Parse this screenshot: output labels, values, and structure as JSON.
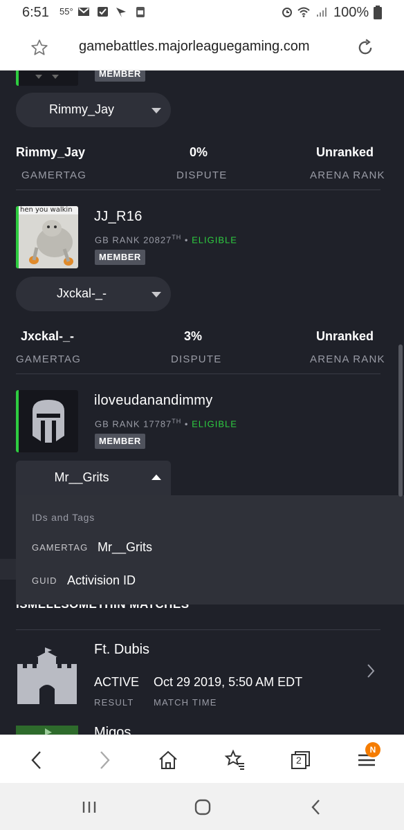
{
  "status_bar": {
    "time": "6:51",
    "temp": "55°",
    "battery": "100%"
  },
  "browser": {
    "url": "gamebattles.majorleaguegaming.com",
    "tabs_count": "2",
    "menu_badge": "N"
  },
  "members": [
    {
      "badge": "MEMBER",
      "selected_gamertag": "Rimmy_Jay",
      "stats": {
        "gamertag": "Rimmy_Jay",
        "dispute": "0%",
        "arena_rank": "Unranked"
      }
    },
    {
      "name": "JJ_R16",
      "gb_rank_prefix": "GB RANK 20827",
      "gb_rank_suffix": "TH",
      "eligibility": "ELIGIBLE",
      "badge": "MEMBER",
      "avatar_caption": "hen you walkin",
      "selected_gamertag": "Jxckal-_-",
      "stats": {
        "gamertag": "Jxckal-_-",
        "dispute": "3%",
        "arena_rank": "Unranked"
      }
    },
    {
      "name": "iloveudanandimmy",
      "gb_rank_prefix": "GB RANK 17787",
      "gb_rank_suffix": "TH",
      "eligibility": "ELIGIBLE",
      "badge": "MEMBER",
      "selected_gamertag": "Mr__Grits"
    }
  ],
  "stat_labels": {
    "gamertag": "GAMERTAG",
    "dispute": "DISPUTE",
    "arena_rank": "ARENA RANK"
  },
  "dropdown": {
    "group_label": "IDs and Tags",
    "options": [
      {
        "type": "GAMERTAG",
        "value": "Mr__Grits"
      },
      {
        "type": "GUID",
        "value": "Activision ID"
      }
    ]
  },
  "matches": {
    "section_title": "ISMELLSOMETHIN MATCHES",
    "items": [
      {
        "title": "Ft. Dubis",
        "result": "ACTIVE",
        "match_time": "Oct 29 2019, 5:50 AM EDT",
        "result_label": "RESULT",
        "time_label": "MATCH TIME"
      },
      {
        "title": "Migos"
      }
    ]
  },
  "colors": {
    "background": "#1f2129",
    "eligible": "#2ecc40",
    "badge_orange": "#f57c00"
  }
}
